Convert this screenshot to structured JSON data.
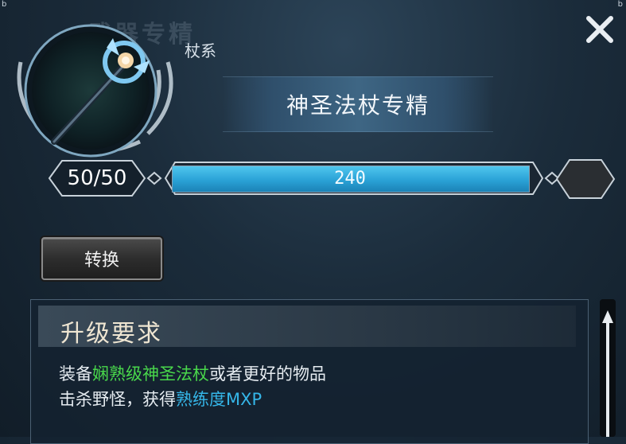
{
  "header": {
    "faded_title": "武器专精",
    "category": "杖系",
    "close_icon": "close-icon"
  },
  "mastery": {
    "title": "神圣法杖专精",
    "level": "50/50",
    "bar_value": "240",
    "bar_fill_fraction": 1.0,
    "weapon_icon": "holy-staff-icon"
  },
  "actions": {
    "convert_label": "转换"
  },
  "requirements": {
    "title": "升级要求",
    "line1_prefix": "装备",
    "line1_highlight": "娴熟级神圣法杖",
    "line1_suffix": "或者更好的物品",
    "line2_prefix": "击杀野怪，获得",
    "line2_highlight": "熟练度MXP"
  },
  "colors": {
    "bar_fill": "#2aa2d6",
    "highlight_green": "#49d84b",
    "highlight_blue": "#35b6e8"
  }
}
